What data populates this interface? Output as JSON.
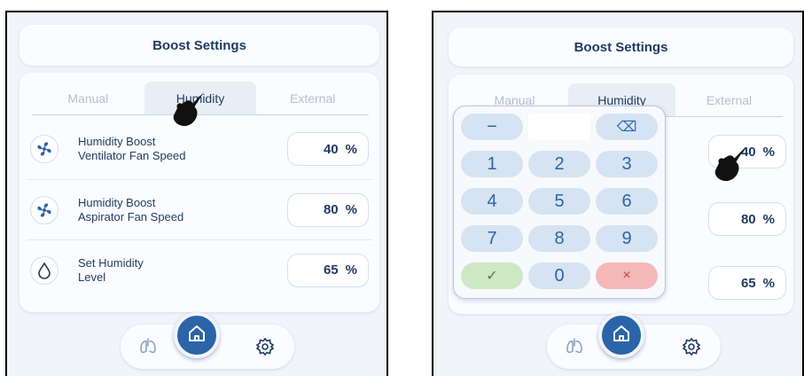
{
  "panels": [
    {
      "title": "Boost Settings",
      "tabs": [
        "Manual",
        "Humidity",
        "External"
      ],
      "active_tab": "Humidity",
      "rows": [
        {
          "label_line1": "Humidity Boost",
          "label_line2": "Ventilator Fan Speed",
          "value": "40",
          "unit": "%",
          "icon": "fan-icon"
        },
        {
          "label_line1": "Humidity Boost",
          "label_line2": "Aspirator Fan Speed",
          "value": "80",
          "unit": "%",
          "icon": "fan-icon"
        },
        {
          "label_line1": "Set Humidity",
          "label_line2": "Level",
          "value": "65",
          "unit": "%",
          "icon": "droplet-icon"
        }
      ],
      "nav": [
        "lungs-icon",
        "home-icon",
        "gear-icon"
      ]
    },
    {
      "title": "Boost Settings",
      "tabs": [
        "Manual",
        "Humidity",
        "External"
      ],
      "active_tab": "Humidity",
      "values": [
        {
          "value": "40",
          "unit": "%"
        },
        {
          "value": "80",
          "unit": "%"
        },
        {
          "value": "65",
          "unit": "%"
        }
      ],
      "keypad": {
        "top_row": [
          "−",
          "",
          "⌫"
        ],
        "rows": [
          [
            "1",
            "2",
            "3"
          ],
          [
            "4",
            "5",
            "6"
          ],
          [
            "7",
            "8",
            "9"
          ]
        ],
        "bottom_row": [
          "✓",
          "0",
          "×"
        ]
      },
      "nav": [
        "lungs-icon",
        "home-icon",
        "gear-icon"
      ]
    }
  ],
  "colors": {
    "accent": "#2b64a8",
    "background": "#f1f4f9",
    "card": "#fafcff",
    "ok_key": "#cde9c4",
    "cancel_key": "#f4b8b8"
  }
}
